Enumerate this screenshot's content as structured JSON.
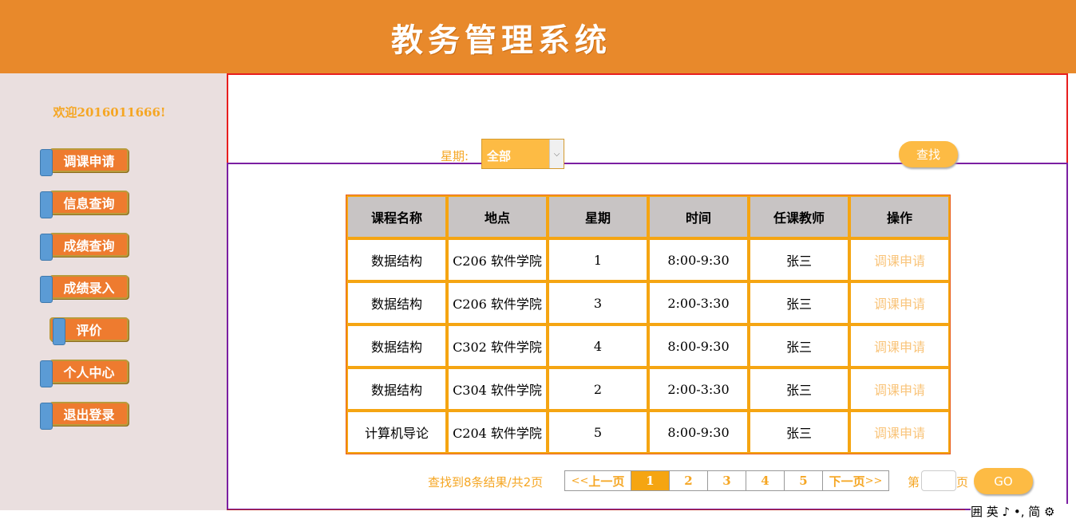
{
  "header": {
    "title": "教务管理系统"
  },
  "sidebar": {
    "welcome": "欢迎2016011666!",
    "items": [
      {
        "label": "调课申请"
      },
      {
        "label": "信息查询"
      },
      {
        "label": "成绩查询"
      },
      {
        "label": "成绩录入"
      },
      {
        "label": "评价"
      },
      {
        "label": "个人中心"
      },
      {
        "label": "退出登录"
      }
    ]
  },
  "filter": {
    "day_label": "星期:",
    "day_selected": "全部",
    "search_label": "查找"
  },
  "table": {
    "headers": [
      "课程名称",
      "地点",
      "星期",
      "时间",
      "任课教师",
      "操作"
    ],
    "rows": [
      {
        "course": "数据结构",
        "location": "C206 软件学院",
        "day": "1",
        "time": "8:00-9:30",
        "teacher": "张三",
        "action": "调课申请"
      },
      {
        "course": "数据结构",
        "location": "C206 软件学院",
        "day": "3",
        "time": "2:00-3:30",
        "teacher": "张三",
        "action": "调课申请"
      },
      {
        "course": "数据结构",
        "location": "C302 软件学院",
        "day": "4",
        "time": "8:00-9:30",
        "teacher": "张三",
        "action": "调课申请"
      },
      {
        "course": "数据结构",
        "location": "C304 软件学院",
        "day": "2",
        "time": "2:00-3:30",
        "teacher": "张三",
        "action": "调课申请"
      },
      {
        "course": "计算机导论",
        "location": "C204 软件学院",
        "day": "5",
        "time": "8:00-9:30",
        "teacher": "张三",
        "action": "调课申请"
      }
    ]
  },
  "pagination": {
    "result_text": "查找到8条结果/共2页",
    "prev_label": "上一页",
    "prev_arrows": "<<",
    "next_label": "下一页",
    "next_arrows": ">>",
    "pages": [
      "1",
      "2",
      "3",
      "4",
      "5"
    ],
    "current_page": "1",
    "goto_prefix": "第",
    "goto_suffix": "页",
    "goto_value": "",
    "go_label": "GO"
  },
  "ime": {
    "text": "囲 英 ♪ •, 简 ⚙"
  },
  "colors": {
    "header_bg": "#E8892B",
    "sidebar_bg": "#EADFDF",
    "accent": "#F5A623",
    "nav_button": "#EE7B2F",
    "nav_tab": "#5B9BD5",
    "table_border": "#F5A512",
    "table_header_bg": "#C8C4C4"
  }
}
